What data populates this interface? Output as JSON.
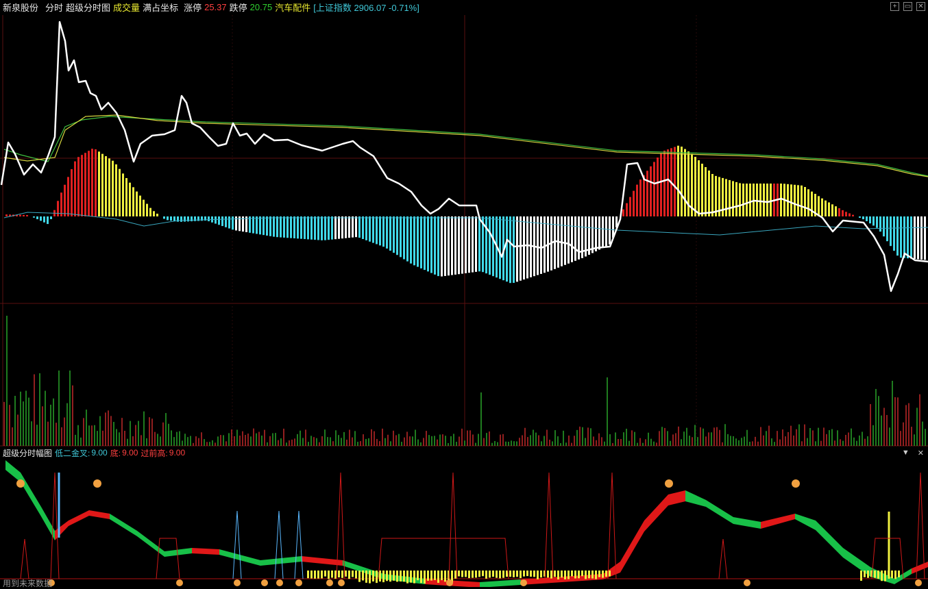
{
  "header": {
    "stock_name": "新泉股份",
    "mode": "分时",
    "chart_title": "超级分时图",
    "volume_label": "成交量",
    "fullscale_label": "满占坐标",
    "limit_up_label": "涨停",
    "limit_up_value": "25.37",
    "limit_down_label": "跌停",
    "limit_down_value": "20.75",
    "sector": "汽车配件",
    "index_text": "[上证指数 2906.07 -0.71%]"
  },
  "indicator": {
    "name": "超级分时幅图",
    "item1_label": "低二金叉:",
    "item1_value": "9.00",
    "item2_label": "底:",
    "item2_value": "9.00",
    "item3_label": "过前高:",
    "item3_value": "9.00"
  },
  "footer": {
    "text": "用到未来数据"
  },
  "colors": {
    "background": "#000000",
    "price_line": "#ffffff",
    "avg_line_green": "#3fbf3f",
    "avg_line_yellow": "#d8d840",
    "hist_red": "#e02020",
    "hist_yellow": "#f0f040",
    "hist_cyan": "#40d8e8",
    "hist_white": "#ffffff",
    "grid": "#5a1010",
    "vol_up": "#e03030",
    "vol_down": "#30c030"
  }
}
